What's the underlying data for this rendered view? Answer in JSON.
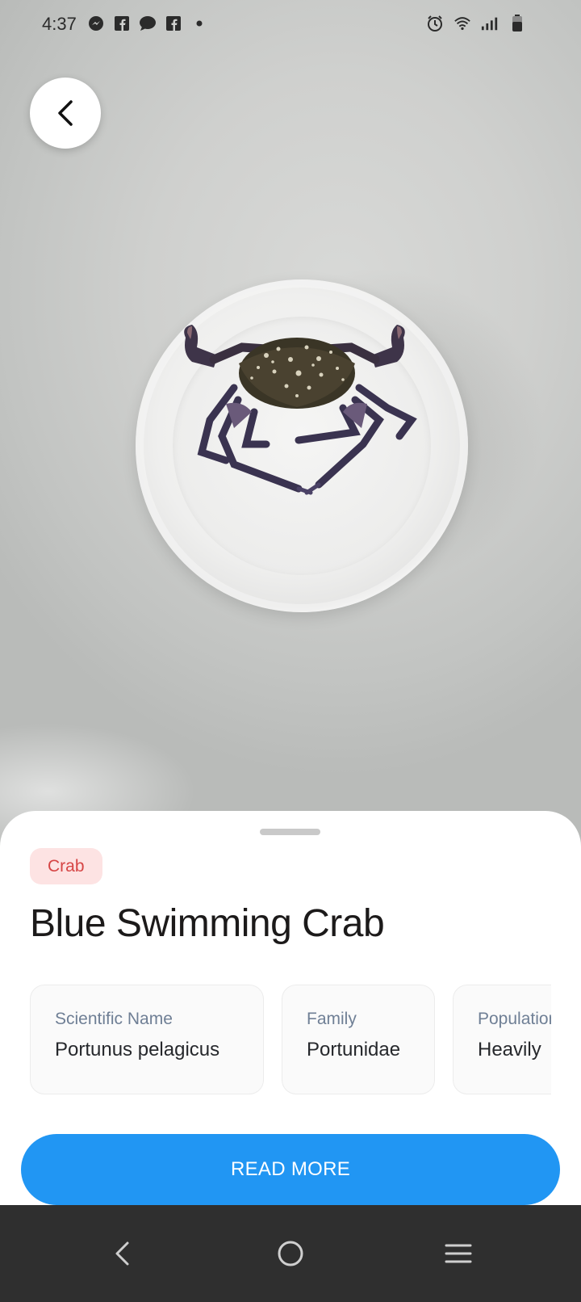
{
  "status_bar": {
    "time": "4:37",
    "left_icons": [
      "messenger-icon",
      "facebook-icon",
      "chat-bubble-icon",
      "facebook-icon",
      "dot-icon"
    ],
    "right_icons": [
      "alarm-icon",
      "wifi-icon",
      "signal-icon",
      "battery-icon"
    ]
  },
  "header": {
    "back_icon": "chevron-left-icon"
  },
  "sheet": {
    "category_badge": "Crab",
    "title": "Blue Swimming Crab",
    "info_cards": [
      {
        "label": "Scientific Name",
        "value": "Portunus pelagicus"
      },
      {
        "label": "Family",
        "value": "Portunidae"
      },
      {
        "label": "Population",
        "value": "Heavily"
      }
    ],
    "read_more_label": "READ MORE"
  },
  "colors": {
    "accent_blue": "#2196f3",
    "badge_bg": "#fde3e3",
    "badge_text": "#d64545",
    "nav_bar": "#2f2f2f"
  },
  "nav_bar": {
    "buttons": [
      "back-icon",
      "home-icon",
      "recents-icon"
    ]
  }
}
